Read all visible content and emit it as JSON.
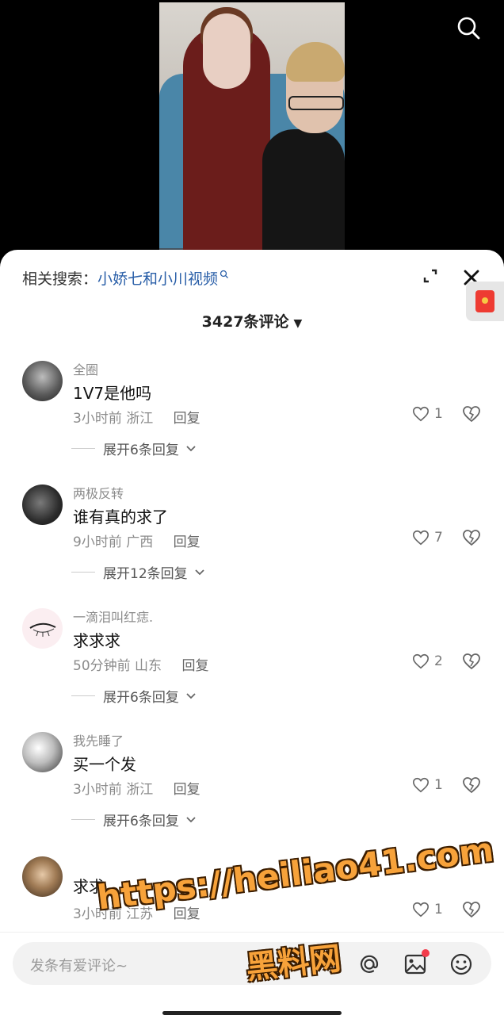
{
  "header": {
    "related_label": "相关搜索：",
    "related_query": "小娇七和小川视频",
    "comment_count": "3427条评论"
  },
  "comments": [
    {
      "user": "全圈",
      "text": "1V7是他吗",
      "time": "3小时前",
      "location": "浙江",
      "reply": "回复",
      "likes": "1",
      "expand": "展开6条回复"
    },
    {
      "user": "两极反转",
      "text": "谁有真的求了",
      "time": "9小时前",
      "location": "广西",
      "reply": "回复",
      "likes": "7",
      "expand": "展开12条回复"
    },
    {
      "user": "一滴泪叫红痣.",
      "text": "求求求",
      "time": "50分钟前",
      "location": "山东",
      "reply": "回复",
      "likes": "2",
      "expand": "展开6条回复"
    },
    {
      "user": "我先睡了",
      "text": "买一个发",
      "time": "3小时前",
      "location": "浙江",
      "reply": "回复",
      "likes": "1",
      "expand": "展开6条回复"
    },
    {
      "user": "",
      "text": "求求",
      "time": "3小时前",
      "location": "江苏",
      "reply": "回复",
      "likes": "1",
      "expand": ""
    }
  ],
  "input": {
    "placeholder": "发条有爱评论~"
  },
  "watermark": {
    "line1": "https://heiliao41.com",
    "line2": "黑料网"
  },
  "colors": {
    "link": "#2a5fa8",
    "redpacket": "#ee3b32",
    "watermark": "#f7a23a"
  }
}
